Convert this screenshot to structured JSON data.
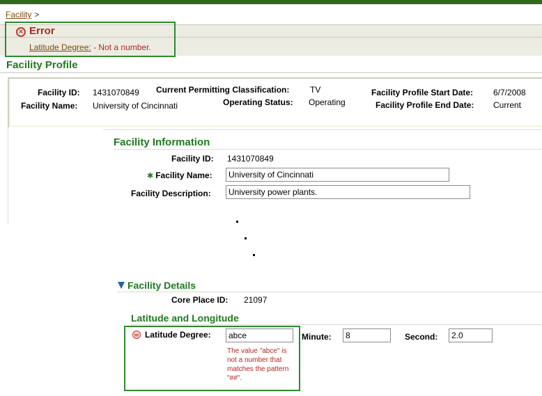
{
  "breadcrumb": {
    "link": "Facility",
    "separator": ">"
  },
  "error": {
    "title": "Error",
    "field_link": "Latitude Degree:",
    "message": " - Not a number."
  },
  "profile": {
    "title": "Facility Profile",
    "facility_id_label": "Facility ID:",
    "facility_id": "1431070849",
    "facility_name_label": "Facility Name:",
    "facility_name": "University of Cincinnati",
    "permit_class_label": "Current Permitting Classification:",
    "permit_class": "TV",
    "op_status_label": "Operating Status:",
    "op_status": "Operating",
    "start_date_label": "Facility Profile Start Date:",
    "start_date": "6/7/2008",
    "end_date_label": "Facility Profile End Date:",
    "end_date": "Current"
  },
  "facility_info": {
    "title": "Facility Information",
    "facility_id_label": "Facility ID:",
    "facility_id": "1431070849",
    "facility_name_label": "Facility Name:",
    "facility_name_value": "University of Cincinnati",
    "description_label": "Facility Description:",
    "description_value": "University power plants."
  },
  "facility_details": {
    "title": "Facility Details",
    "core_place_label": "Core Place ID:",
    "core_place": "21097"
  },
  "latlong": {
    "title": "Latitude and Longitude",
    "lat_degree_label": "Latitude Degree:",
    "lat_degree_value": "abce",
    "minute_label": "Minute:",
    "minute_value": "8",
    "second_label": "Second:",
    "second_value": "2.0",
    "validation_message": "The value \"abce\" is not a number that matches the pattern \"##\"."
  },
  "colors": {
    "accent_green": "#1e7a1e",
    "error_red": "#b3261e",
    "top_bar": "#2e6b1f"
  }
}
